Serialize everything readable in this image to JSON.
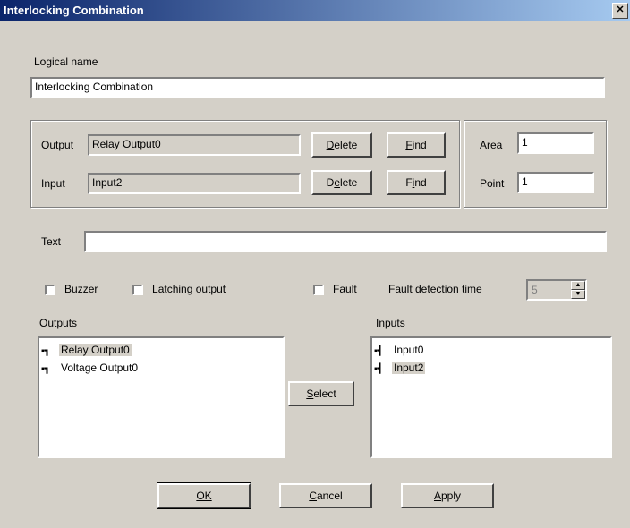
{
  "window": {
    "title": "Interlocking Combination",
    "close_glyph": "✕"
  },
  "logical_name": {
    "label": "Logical name",
    "value": "Interlocking Combination"
  },
  "output": {
    "label": "Output",
    "value": "Relay Output0",
    "delete_label": "Delete",
    "delete_key": "D",
    "find_label": "Find",
    "find_key": "F"
  },
  "input": {
    "label": "Input",
    "value": "Input2",
    "delete_label": "Delete",
    "delete_key": "e",
    "find_label": "Find",
    "find_key": "i"
  },
  "area": {
    "label": "Area",
    "value": "1"
  },
  "point": {
    "label": "Point",
    "value": "1"
  },
  "text": {
    "label": "Text",
    "value": ""
  },
  "options": {
    "buzzer": {
      "label": "Buzzer",
      "key": "B",
      "checked": false
    },
    "latching": {
      "label": "Latching output",
      "key": "L",
      "checked": false
    },
    "fault": {
      "label": "Fault",
      "key": "u",
      "checked": false
    },
    "fault_time_label": "Fault detection time",
    "fault_time_value": "5"
  },
  "outputs": {
    "label": "Outputs",
    "items": [
      {
        "label": "Relay Output0",
        "selected": true,
        "icon": "relay-output-icon"
      },
      {
        "label": "Voltage Output0",
        "selected": false,
        "icon": "voltage-output-icon"
      }
    ]
  },
  "inputs": {
    "label": "Inputs",
    "items": [
      {
        "label": "Input0",
        "selected": false,
        "icon": "input-icon"
      },
      {
        "label": "Input2",
        "selected": true,
        "icon": "input-icon"
      }
    ]
  },
  "buttons": {
    "select": "Select",
    "ok": "OK",
    "cancel": "Cancel",
    "apply": "Apply"
  }
}
